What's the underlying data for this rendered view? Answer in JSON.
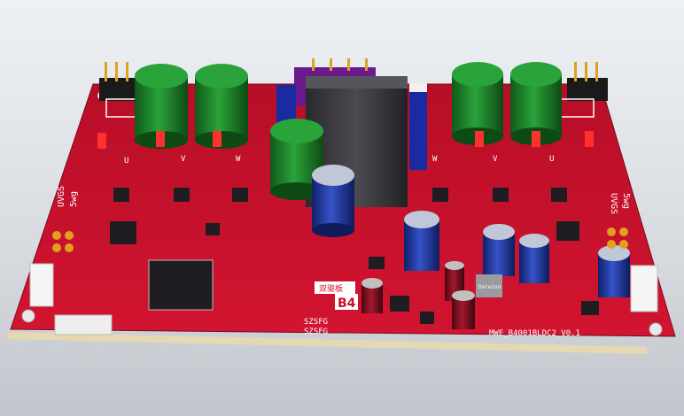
{
  "board": {
    "part_number": "MWE_B4001BLDC2_V0.1",
    "model_mark": "B4",
    "chinese_mark": "双驱板",
    "left_hall_labels": [
      "UVGS",
      "5wg"
    ],
    "right_hall_labels": [
      "UVGS",
      "5wg"
    ],
    "bottom_pin_labels_top": "SZSFG",
    "bottom_pin_labels_bottom": "SZSFG",
    "phase_labels_left": [
      "U",
      "V",
      "W"
    ],
    "phase_labels_right": [
      "U",
      "V",
      "W"
    ],
    "inductor_label": "Darwinn"
  },
  "colors": {
    "solder_mask": "#c8102e",
    "silkscreen": "#ffffff",
    "electrolytic_green": "#1f8a2a",
    "electrolytic_blue": "#1f3aa8",
    "electrolytic_maroon": "#7a1020",
    "header_pins": "#e0a020",
    "background": "#dfe3e8"
  },
  "icons": [
    "pcb-board-icon"
  ]
}
